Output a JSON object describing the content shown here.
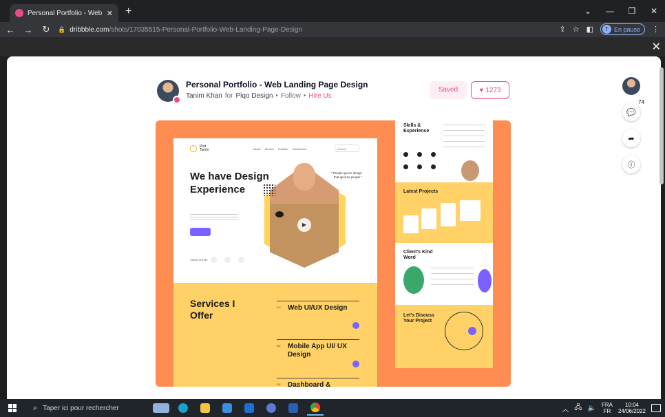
{
  "browser": {
    "tab_title": "Personal Portfolio - Web Landing",
    "new_tab_symbol": "+",
    "url_domain": "dribbble.com",
    "url_path": "/shots/17035515-Personal-Portfolio-Web-Landing-Page-Design",
    "profile_initial": "T",
    "profile_status": "En pause"
  },
  "shot": {
    "title": "Personal Portfolio - Web Landing Page Design",
    "author": "Tanim Khan",
    "for_word": "for",
    "team": "Piqo Design",
    "separator": "•",
    "follow": "Follow",
    "hire": "Hire Us",
    "saved_label": "Saved",
    "likes": "1273",
    "comments_count": "74"
  },
  "preview": {
    "logo_text": "Port. Tanim",
    "nav": [
      "About",
      "Service",
      "Portfolio",
      "Testimonial"
    ],
    "search_placeholder": "Search",
    "hero": "We have Design Experience",
    "quote": "\" People ignore design that ignores people \"",
    "check_for_me": "Check Out Me",
    "services_heading": "Services I Offer",
    "services": [
      {
        "num": "01/",
        "label": "Web UI/UX Design"
      },
      {
        "num": "02/",
        "label": "Mobile App UI/ UX Design"
      },
      {
        "num": "03/",
        "label": "Dashboard &"
      }
    ],
    "side_headings": [
      "Skills & Experience",
      "Latest Projects",
      "Client's Kind Word",
      "Let's Discuss Your Project"
    ]
  },
  "taskbar": {
    "search_placeholder": "Taper ici pour rechercher",
    "lang_top": "FRA",
    "lang_bottom": "FR",
    "time": "10:04",
    "date": "24/06/2022"
  },
  "colors": {
    "accent": "#ea4c89",
    "shot_bg": "#ff8c50",
    "preview_yellow": "#ffd166",
    "preview_purple": "#7b61ff"
  }
}
